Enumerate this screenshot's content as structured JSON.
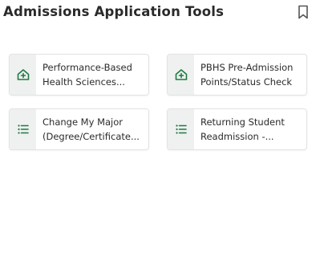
{
  "header": {
    "title": "Admissions Application Tools",
    "bookmark_icon": "bookmark-icon"
  },
  "accent_color": "#1e7a45",
  "cards": [
    {
      "line1": "Performance-Based",
      "line2": "Health Sciences...",
      "icon": "home-plus-icon"
    },
    {
      "line1": "PBHS Pre-Admission",
      "line2": "Points/Status Check",
      "icon": "home-plus-icon"
    },
    {
      "line1": "Change My Major",
      "line2": "(Degree/Certificate...",
      "icon": "list-icon"
    },
    {
      "line1": "Returning Student",
      "line2": "Readmission -...",
      "icon": "list-icon"
    }
  ]
}
